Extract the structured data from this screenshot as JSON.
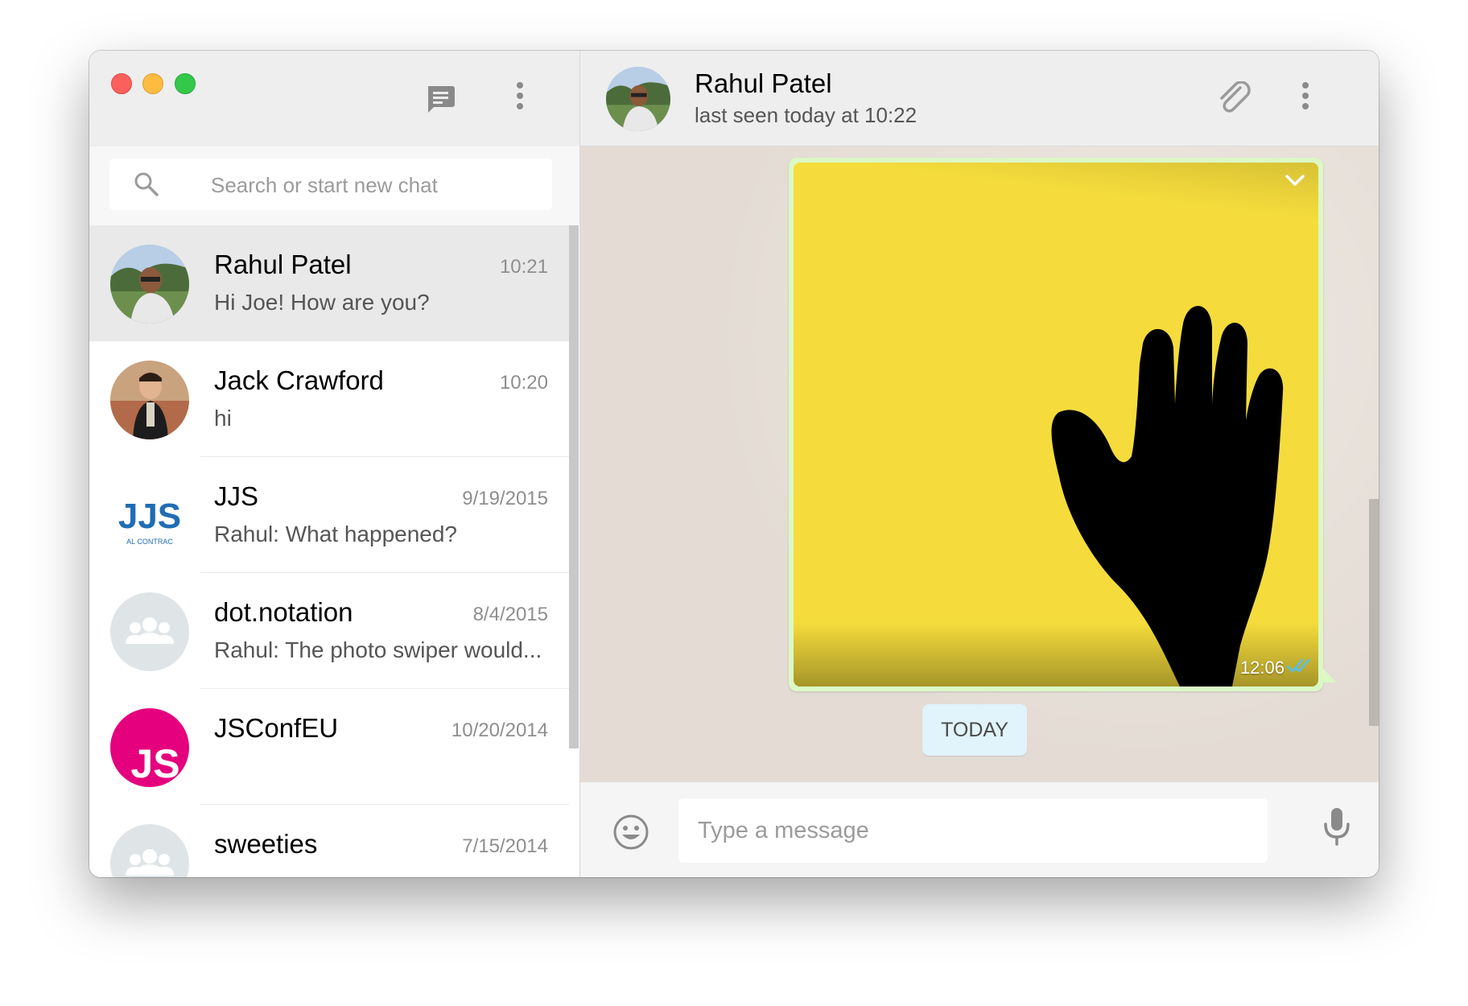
{
  "sidebar": {
    "search": {
      "placeholder": "Search or start new chat"
    },
    "chats": [
      {
        "name": "Rahul Patel",
        "time": "10:21",
        "preview": "Hi Joe! How are you?",
        "avatar": "photo-rahul",
        "active": true
      },
      {
        "name": "Jack Crawford",
        "time": "10:20",
        "preview": "hi",
        "avatar": "photo-jack",
        "active": false
      },
      {
        "name": "JJS",
        "time": "9/19/2015",
        "preview": "Rahul: What happened?",
        "avatar": "jjs-logo",
        "active": false
      },
      {
        "name": "dot.notation",
        "time": "8/4/2015",
        "preview": "Rahul: The photo swiper would...",
        "avatar": "group-icon",
        "active": false
      },
      {
        "name": "JSConfEU",
        "time": "10/20/2014",
        "preview": "",
        "avatar": "jsconf-logo",
        "active": false
      },
      {
        "name": "sweeties",
        "time": "7/15/2014",
        "preview": "",
        "avatar": "group-icon",
        "active": false
      }
    ],
    "avatar_texts": {
      "jjs": "JJS",
      "jjs_sub": "AL CONTRAC",
      "jsconf": "JS"
    }
  },
  "conversation": {
    "contact_name": "Rahul Patel",
    "contact_status": "last seen today at 10:22",
    "message": {
      "type": "image",
      "time": "12:06",
      "status": "read",
      "image": "black hand silhouette on yellow background"
    },
    "date_label": "TODAY",
    "composer": {
      "placeholder": "Type a message"
    }
  },
  "colors": {
    "bubble_out": "#dcf8c6",
    "chat_bg": "#e4dcd4",
    "header_bg": "#eeeeee",
    "active_chat": "#e9e9e9",
    "date_chip": "#e1f3fb",
    "jsconf_pink": "#e5007d",
    "jjs_blue": "#1f6db5",
    "read_ticks": "#4fc3f7",
    "image_yellow": "#f5dc3c"
  }
}
